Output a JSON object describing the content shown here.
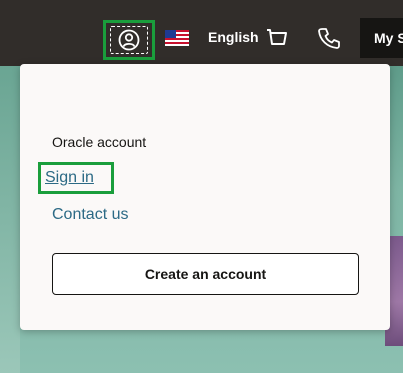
{
  "header": {
    "language_label": "English",
    "my_button_label": "My S",
    "icons": {
      "account": "account-icon",
      "flag": "us-flag-icon",
      "cart": "cart-icon",
      "phone": "phone-icon"
    }
  },
  "dropdown": {
    "heading": "Oracle account",
    "sign_in_label": "Sign in",
    "contact_label": "Contact us",
    "create_account_label": "Create an account"
  },
  "colors": {
    "nav_background": "#312d2a",
    "focus_outline": "#1a9e3c",
    "link": "#2c6a85",
    "panel_background": "#fbf9f8"
  }
}
